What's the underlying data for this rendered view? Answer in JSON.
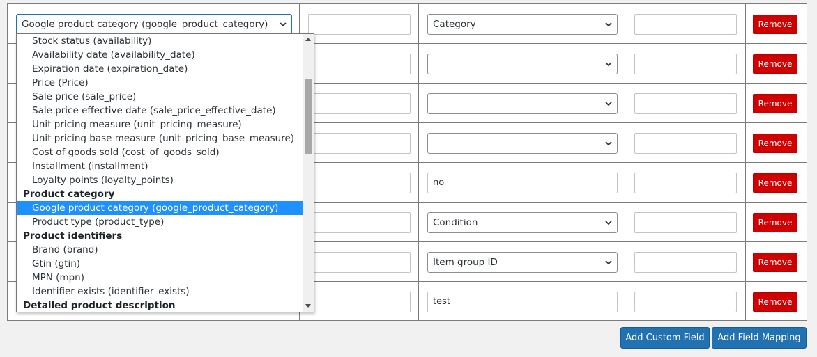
{
  "rows": [
    {
      "source_select": "Google product category (google_product_category)",
      "prefix": "",
      "value_type": "select",
      "value": "Category",
      "suffix": "",
      "remove_label": "Remove"
    },
    {
      "prefix": "",
      "value_type": "select",
      "value": "",
      "suffix": "",
      "remove_label": "Remove"
    },
    {
      "prefix": "",
      "value_type": "select",
      "value": "",
      "suffix": "",
      "remove_label": "Remove"
    },
    {
      "prefix": "",
      "value_type": "select",
      "value": "",
      "suffix": "",
      "remove_label": "Remove"
    },
    {
      "prefix": "",
      "value_type": "text",
      "value": "no",
      "suffix": "",
      "remove_label": "Remove"
    },
    {
      "prefix": "",
      "value_type": "select",
      "value": "Condition",
      "suffix": "",
      "remove_label": "Remove"
    },
    {
      "prefix": "",
      "value_type": "select",
      "value": "Item group ID",
      "suffix": "",
      "remove_label": "Remove"
    },
    {
      "prefix": "",
      "value_type": "text",
      "value": "test",
      "suffix": "",
      "remove_label": "Remove"
    }
  ],
  "dropdown": {
    "options": [
      {
        "label": "Stock status (availability)",
        "group": false,
        "selected": false
      },
      {
        "label": "Availability date (availability_date)",
        "group": false,
        "selected": false
      },
      {
        "label": "Expiration date (expiration_date)",
        "group": false,
        "selected": false
      },
      {
        "label": "Price (Price)",
        "group": false,
        "selected": false
      },
      {
        "label": "Sale price (sale_price)",
        "group": false,
        "selected": false
      },
      {
        "label": "Sale price effective date (sale_price_effective_date)",
        "group": false,
        "selected": false
      },
      {
        "label": "Unit pricing measure (unit_pricing_measure)",
        "group": false,
        "selected": false
      },
      {
        "label": "Unit pricing base measure (unit_pricing_base_measure)",
        "group": false,
        "selected": false
      },
      {
        "label": "Cost of goods sold (cost_of_goods_sold)",
        "group": false,
        "selected": false
      },
      {
        "label": "Installment (installment)",
        "group": false,
        "selected": false
      },
      {
        "label": "Loyalty points (loyalty_points)",
        "group": false,
        "selected": false
      },
      {
        "label": "Product category",
        "group": true,
        "selected": false
      },
      {
        "label": "Google product category (google_product_category)",
        "group": false,
        "selected": true
      },
      {
        "label": "Product type (product_type)",
        "group": false,
        "selected": false
      },
      {
        "label": "Product identifiers",
        "group": true,
        "selected": false
      },
      {
        "label": "Brand (brand)",
        "group": false,
        "selected": false
      },
      {
        "label": "Gtin (gtin)",
        "group": false,
        "selected": false
      },
      {
        "label": "MPN (mpn)",
        "group": false,
        "selected": false
      },
      {
        "label": "Identifier exists (identifier_exists)",
        "group": false,
        "selected": false
      },
      {
        "label": "Detailed product description",
        "group": true,
        "selected": false
      }
    ]
  },
  "actions": {
    "add_custom_field": "Add Custom Field",
    "add_field_mapping": "Add Field Mapping"
  },
  "colors": {
    "remove_button": "#d00000",
    "primary_button": "#2271b1",
    "highlight": "#1e90ff"
  }
}
